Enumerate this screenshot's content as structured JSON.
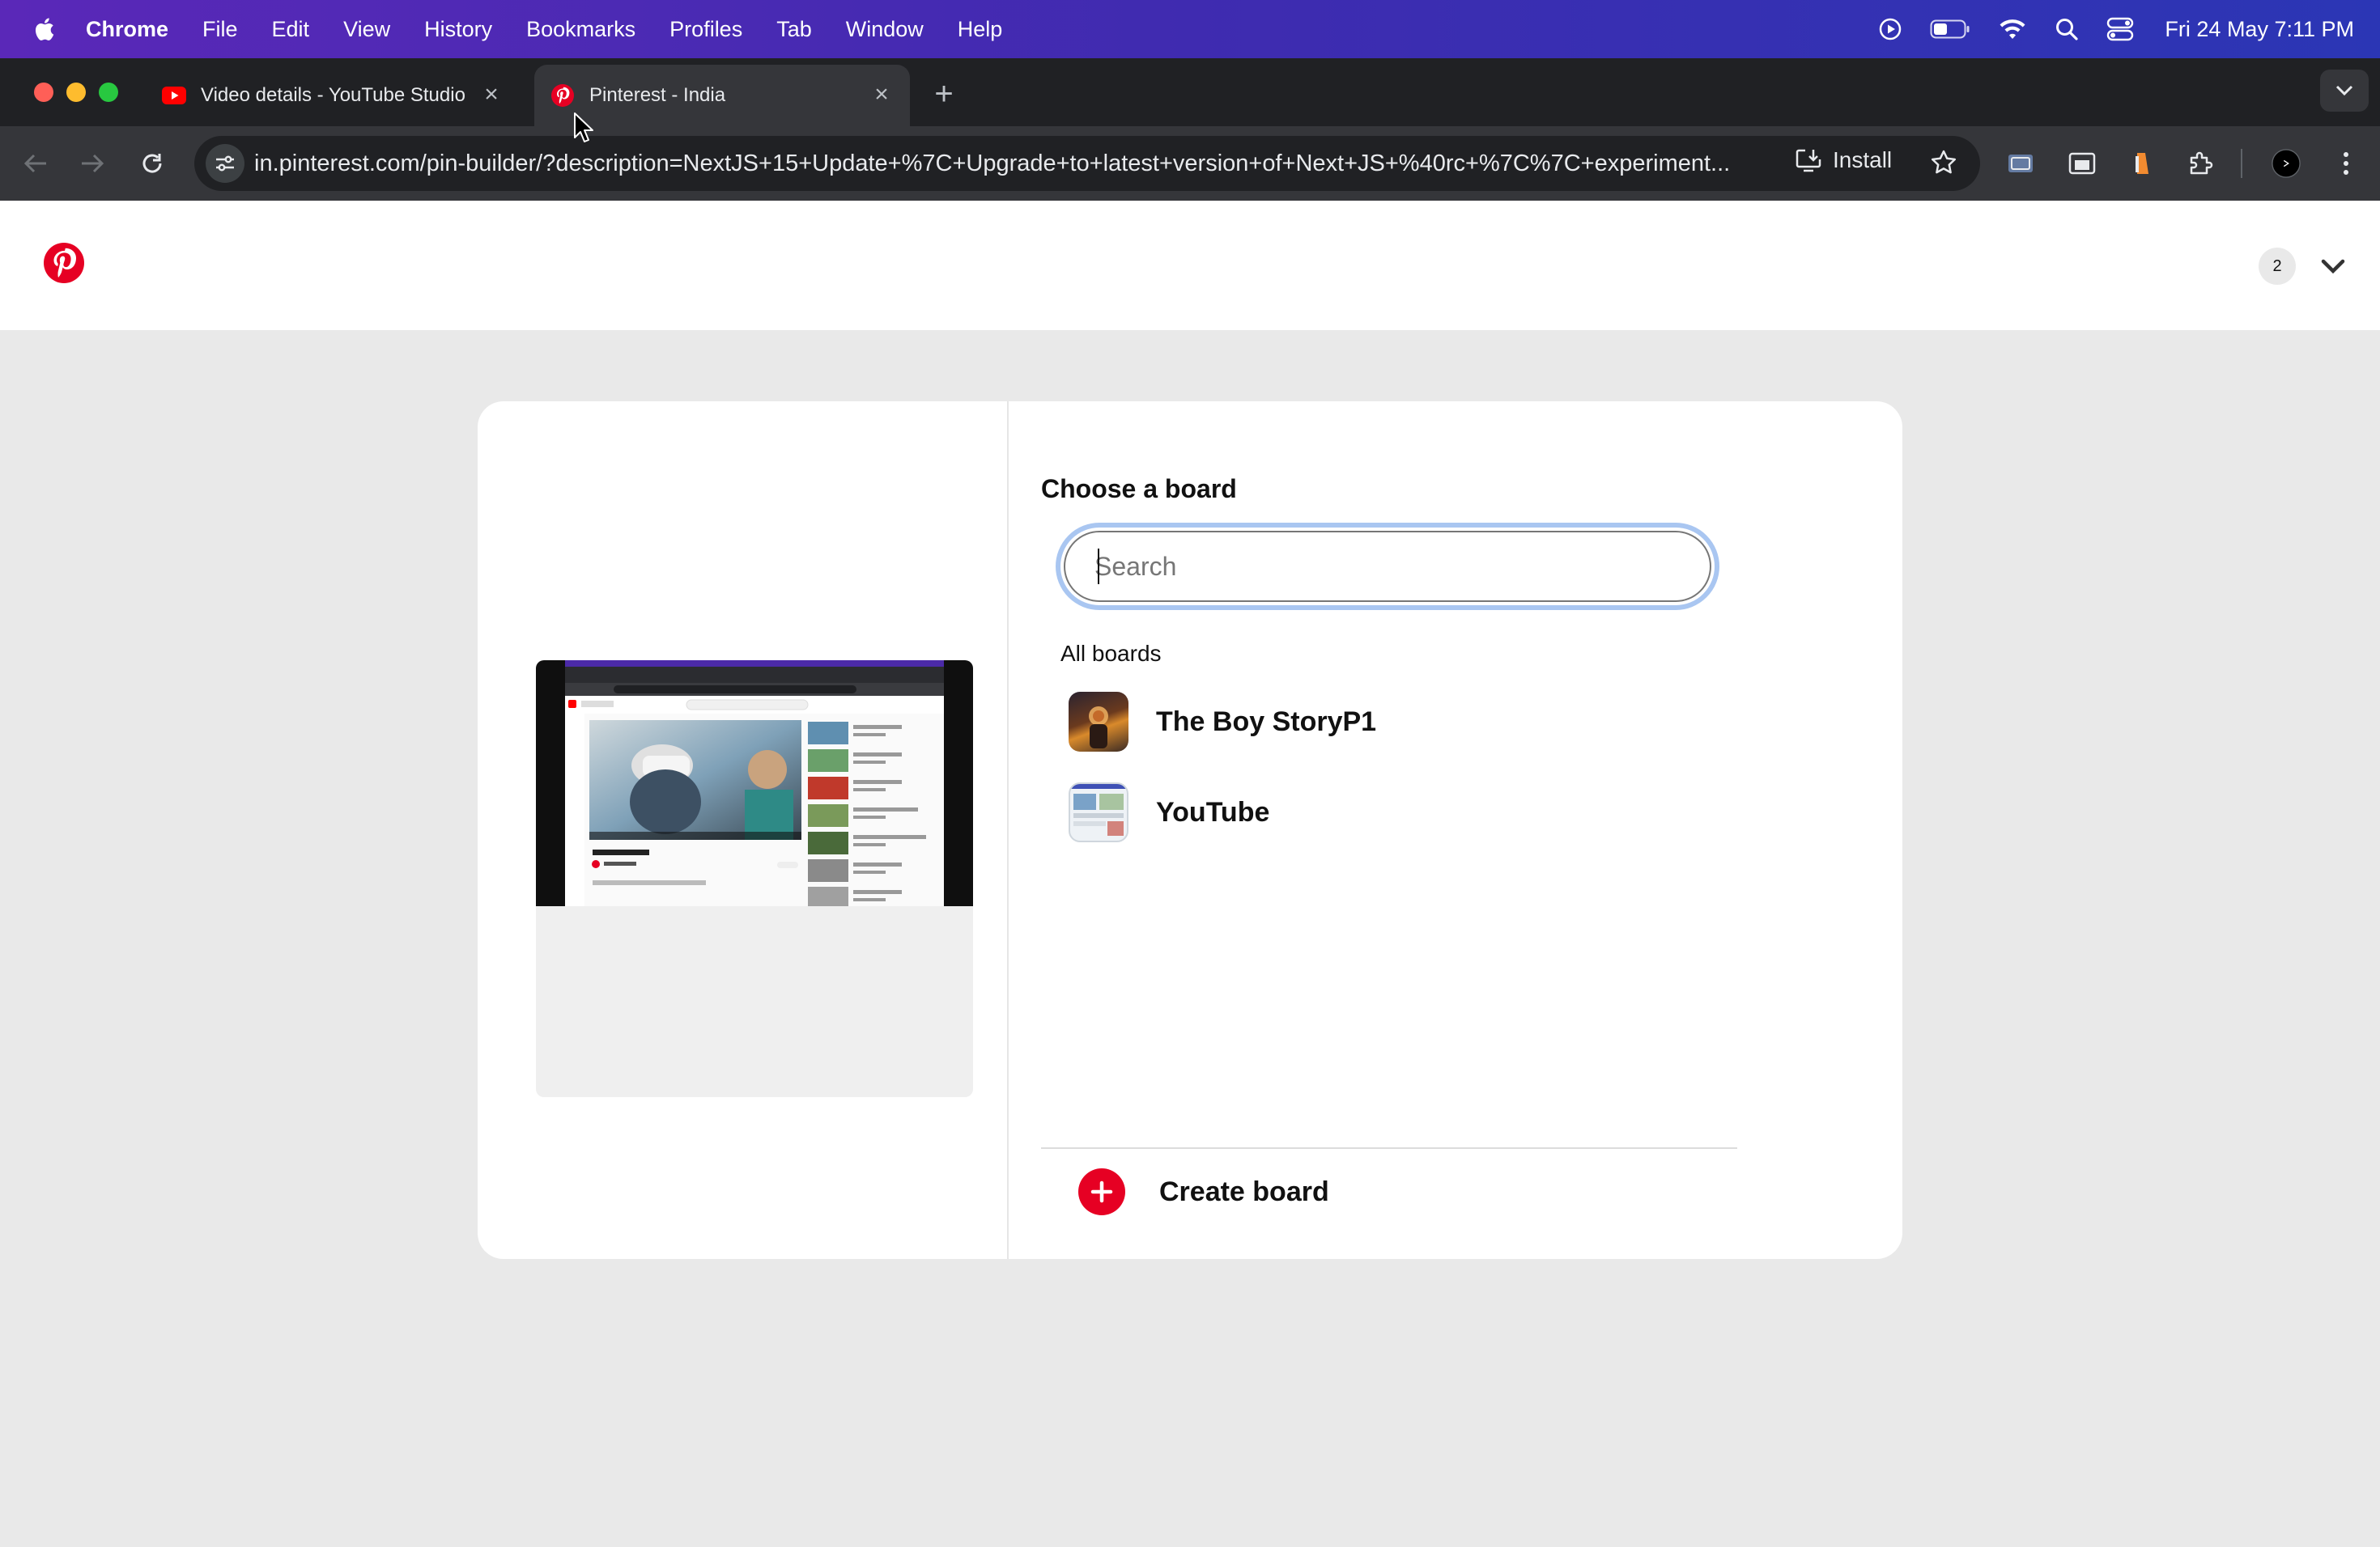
{
  "menubar": {
    "app": "Chrome",
    "items": [
      "File",
      "Edit",
      "View",
      "History",
      "Bookmarks",
      "Profiles",
      "Tab",
      "Window",
      "Help"
    ],
    "status_icons": [
      "play-circle-icon",
      "battery-icon",
      "wifi-icon",
      "spotlight-search-icon",
      "control-center-icon"
    ],
    "clock": "Fri 24 May  7:11 PM"
  },
  "tabs": [
    {
      "title": "Video details - YouTube Studio",
      "favicon": "youtube-icon"
    },
    {
      "title": "Pinterest - India",
      "favicon": "pinterest-icon"
    }
  ],
  "toolbar": {
    "url": "in.pinterest.com/pin-builder/?description=NextJS+15+Update+%7C+Upgrade+to+latest+version+of+Next+JS+%40rc+%7C%7C+experiment...",
    "install_label": "Install"
  },
  "header": {
    "notification_count": "2"
  },
  "board_picker": {
    "title": "Choose a board",
    "search_placeholder": "Search",
    "section_label": "All boards",
    "boards": [
      {
        "name": "The Boy StoryP1"
      },
      {
        "name": "YouTube"
      }
    ],
    "create_label": "Create board"
  },
  "colors": {
    "pinterest_red": "#e60023",
    "focus_ring": "#a9c6f1",
    "page_bg": "#e9e9e9"
  }
}
